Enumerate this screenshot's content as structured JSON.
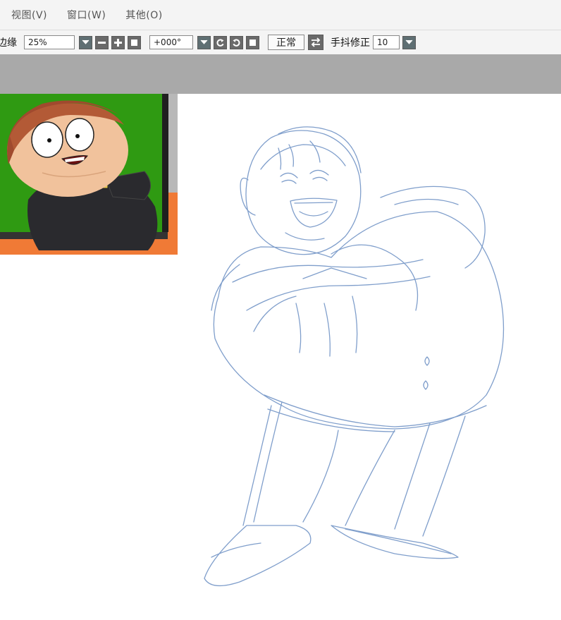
{
  "menu": {
    "items": [
      {
        "label": "视图(V)"
      },
      {
        "label": "窗口(W)"
      },
      {
        "label": "其他(O)"
      }
    ]
  },
  "toolbar": {
    "edge_label": "边缘",
    "zoom_value": "25%",
    "rotation_value": "+000°",
    "normal_label": "正常",
    "stabilizer_label": "手抖修正",
    "stabilizer_value": "10"
  },
  "colors": {
    "toolbar_bg": "#f4f4f4",
    "gray_band": "#a9a9a9",
    "sketch_stroke": "#6d8fc4",
    "ref_green": "#2e9a12",
    "ref_orange": "#ee7a33"
  },
  "icons": {
    "dropdown": "chevron-down-icon",
    "zoom_out": "minus-icon",
    "zoom_in": "plus-icon",
    "zoom_reset": "square-icon",
    "rotate_ccw": "rotate-ccw-icon",
    "rotate_cw": "rotate-cw-icon",
    "rotate_reset": "square-icon",
    "flip": "flip-horizontal-icon"
  }
}
